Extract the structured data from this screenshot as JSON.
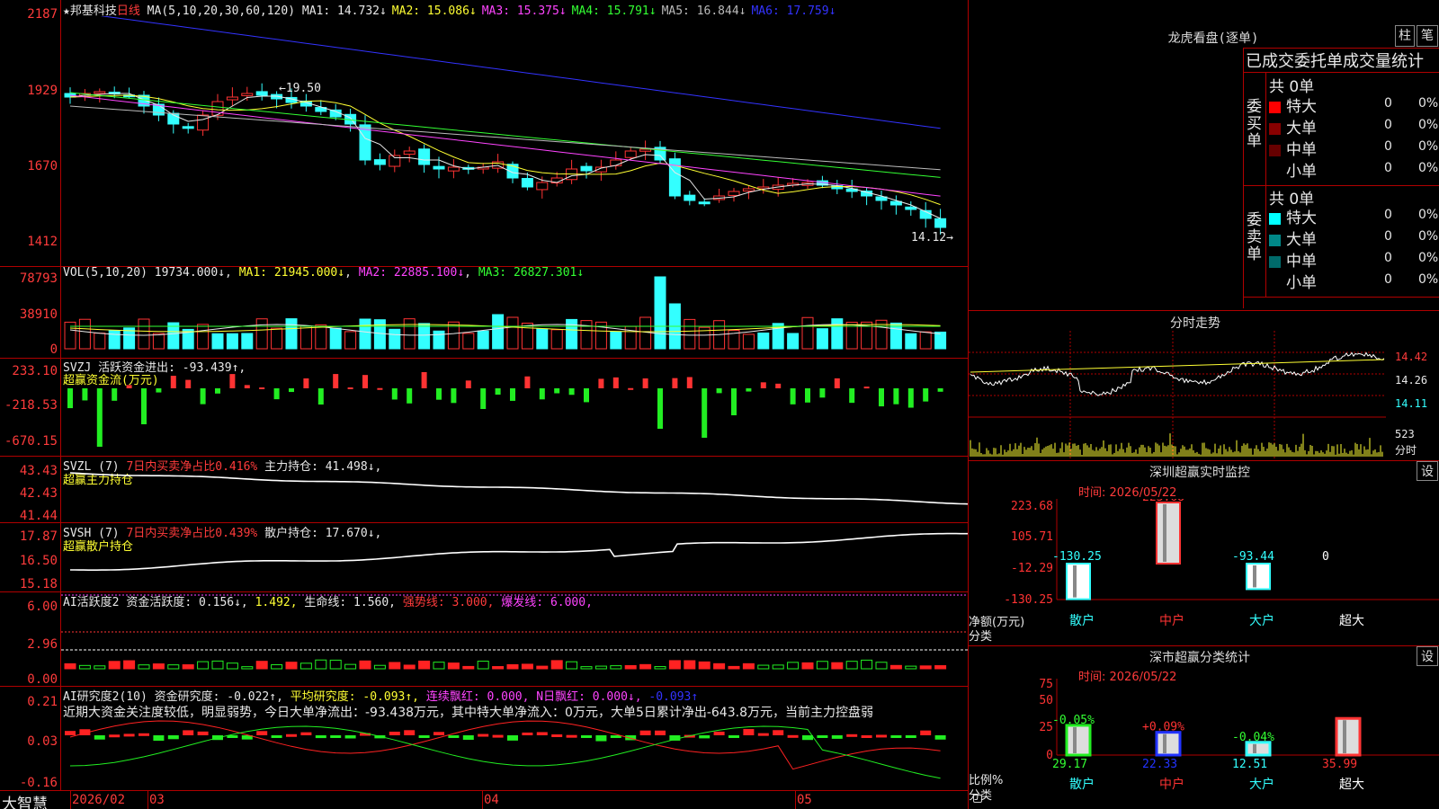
{
  "stock": {
    "name": "★邦基科技",
    "period": "日线",
    "ma_params": "MA(5,10,20,30,60,120)",
    "ma": [
      {
        "label": "MA1: 14.732↓",
        "color": "#e8e8e8"
      },
      {
        "label": "MA2: 15.086↓",
        "color": "#ffff33"
      },
      {
        "label": "MA3: 15.375↓",
        "color": "#ff44ff"
      },
      {
        "label": "MA4: 15.791↓",
        "color": "#33ff33"
      },
      {
        "label": "MA5: 16.844↓",
        "color": "#bbbbbb"
      },
      {
        "label": "MA6: 17.759↓",
        "color": "#3333ff"
      }
    ],
    "y_ticks": [
      "2187",
      "1929",
      "1670",
      "1412"
    ],
    "high_label": "19.50",
    "low_label": "14.12"
  },
  "vol": {
    "params": "VOL(5,10,20)",
    "value": "19734.000↓",
    "ma1": "MA1: 21945.000↓",
    "ma2": "MA2: 22885.100↓",
    "ma3": "MA3: 26827.301↓",
    "y_ticks": [
      "78793",
      "38910",
      "0"
    ]
  },
  "svzj": {
    "name": "SVZJ",
    "text": "活跃资金进出: -93.439↑,",
    "subtitle": "超赢资金流(万元)",
    "y_ticks": [
      "233.10",
      "-218.53",
      "-670.15"
    ]
  },
  "svzl": {
    "name": "SVZL (7)",
    "ratio": "7日内买卖净占比0.416%",
    "hold": "主力持仓: 41.498↓,",
    "subtitle": "超赢主力持仓",
    "y_ticks": [
      "43.43",
      "42.43",
      "41.44"
    ]
  },
  "svsh": {
    "name": "SVSH (7)",
    "ratio": "7日内买卖净占比0.439%",
    "hold": "散户持仓: 17.670↓,",
    "subtitle": "超赢散户持仓",
    "y_ticks": [
      "17.87",
      "16.50",
      "15.18"
    ]
  },
  "ai1": {
    "name": "AI活跃度2",
    "a": "资金活跃度: 0.156↓,",
    "b": "1.492,",
    "c": "生命线: 1.560,",
    "d": "强势线: 3.000,",
    "e": "爆发线: 6.000,",
    "y_ticks": [
      "6.00",
      "2.96",
      "0.00"
    ]
  },
  "ai2": {
    "name": "AI研究度2(10)",
    "a": "资金研究度: -0.022↑,",
    "b": "平均研究度: -0.093↑,",
    "c": "连续飘红: 0.000,",
    "d": "N日飘红: 0.000↓,",
    "e": "-0.093↑",
    "summary": "近期大资金关注度较低，明显弱势，今日大单净流出：-93.438万元，其中特大单净流入：0万元，大单5日累计净出-643.8万元，当前主力控盘弱",
    "y_ticks": [
      "0.21",
      "0.03",
      "-0.16"
    ]
  },
  "bottom": {
    "app": "大智慧",
    "dates": [
      "2026/02",
      "03",
      "04",
      "05"
    ]
  },
  "lhb": {
    "title": "龙虎看盘(逐单)",
    "btn1": "柱",
    "btn2": "笔",
    "section": "已成交委托单成交量统计",
    "buy_label": "委买单",
    "sell_label": "委卖单",
    "buy_total": "共 0单",
    "sell_total": "共 0单",
    "buy_rows": [
      {
        "name": "特大",
        "count": "0",
        "pct": "0%",
        "color": "#ff0000"
      },
      {
        "name": "大单",
        "count": "0",
        "pct": "0%",
        "color": "#880000"
      },
      {
        "name": "中单",
        "count": "0",
        "pct": "0%",
        "color": "#660000"
      },
      {
        "name": "小单",
        "count": "0",
        "pct": "0%",
        "color": "#000000"
      }
    ],
    "sell_rows": [
      {
        "name": "特大",
        "count": "0",
        "pct": "0%",
        "color": "#00ffff"
      },
      {
        "name": "大单",
        "count": "0",
        "pct": "0%",
        "color": "#008888"
      },
      {
        "name": "中单",
        "count": "0",
        "pct": "0%",
        "color": "#006a6a"
      },
      {
        "name": "小单",
        "count": "0",
        "pct": "0%",
        "color": "#000000"
      }
    ]
  },
  "intraday": {
    "title": "分时走势",
    "p1": "14.42",
    "p2": "14.26",
    "p3": "14.11",
    "vol": "523",
    "unit": "分时"
  },
  "szmon": {
    "title": "深圳超赢实时监控",
    "set": "设",
    "time": "时间: 2026/05/22",
    "y_ticks": [
      "223.68",
      "105.71",
      "-12.29",
      "-130.25"
    ],
    "ylabel1": "净额(万元)",
    "ylabel2": "分类",
    "cats": [
      "散户",
      "中户",
      "大户",
      "超大"
    ],
    "values": [
      "-130.25",
      "223.68",
      "-93.44",
      "0"
    ]
  },
  "szcls": {
    "title": "深市超赢分类统计",
    "set": "设",
    "time": "时间: 2026/05/22",
    "y_ticks": [
      "75",
      "50",
      "25",
      "0"
    ],
    "ylabel1": "比例%",
    "ylabel2": "分类",
    "cats": [
      "散户",
      "中户",
      "大户",
      "超大"
    ],
    "pct_labels": [
      "-0.05%",
      "+0.09%",
      "-0.04%",
      ""
    ],
    "values": [
      "29.17",
      "22.33",
      "12.51",
      "35.99"
    ]
  }
}
